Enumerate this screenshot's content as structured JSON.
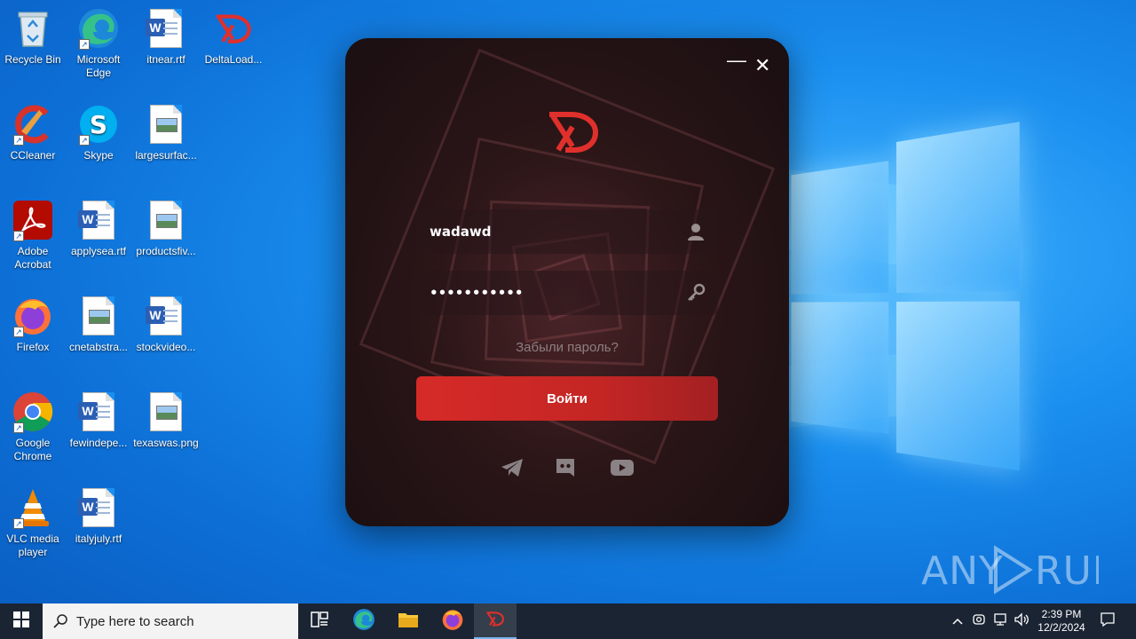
{
  "desktop": {
    "icons": [
      {
        "label": "Recycle Bin",
        "icon": "recycle-bin-icon"
      },
      {
        "label": "Microsoft Edge",
        "icon": "edge-icon"
      },
      {
        "label": "itnear.rtf",
        "icon": "word-document-icon"
      },
      {
        "label": "DeltaLoad...",
        "icon": "deltaload-icon"
      },
      {
        "label": "CCleaner",
        "icon": "ccleaner-icon"
      },
      {
        "label": "Skype",
        "icon": "skype-icon"
      },
      {
        "label": "largesurfac...",
        "icon": "image-file-icon"
      },
      {
        "label": "Adobe Acrobat",
        "icon": "adobe-acrobat-icon"
      },
      {
        "label": "applysea.rtf",
        "icon": "word-document-icon"
      },
      {
        "label": "productsfiv...",
        "icon": "image-file-icon"
      },
      {
        "label": "Firefox",
        "icon": "firefox-icon"
      },
      {
        "label": "cnetabstra...",
        "icon": "image-file-icon"
      },
      {
        "label": "stockvideo...",
        "icon": "word-document-icon"
      },
      {
        "label": "Google Chrome",
        "icon": "chrome-icon"
      },
      {
        "label": "fewindepe...",
        "icon": "word-document-icon"
      },
      {
        "label": "texaswas.png",
        "icon": "image-file-icon"
      },
      {
        "label": "VLC media player",
        "icon": "vlc-icon"
      },
      {
        "label": "italyjuly.rtf",
        "icon": "word-document-icon"
      }
    ]
  },
  "login": {
    "minimize_label": "—",
    "close_label": "✕",
    "username_value": "wadawd",
    "password_value": "•••••••••••",
    "forgot_label": "Забыли пароль?",
    "submit_label": "Войти",
    "accent_color": "#e0302c",
    "socials": [
      "telegram-icon",
      "discord-icon",
      "youtube-icon"
    ]
  },
  "watermark": {
    "text": "ANY RUN"
  },
  "taskbar": {
    "search_placeholder": "Type here to search",
    "time": "2:39 PM",
    "date": "12/2/2024"
  }
}
